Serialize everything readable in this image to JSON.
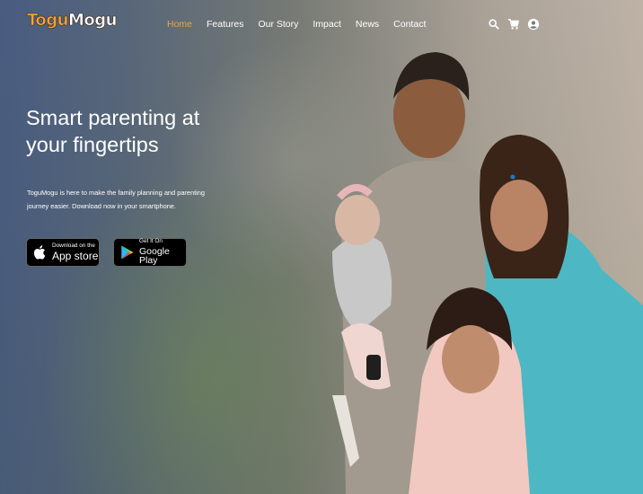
{
  "brand": {
    "logo_part1": "Togu",
    "logo_part2": "Mogu"
  },
  "nav": {
    "items": [
      {
        "label": "Home",
        "active": true
      },
      {
        "label": "Features",
        "active": false
      },
      {
        "label": "Our Story",
        "active": false
      },
      {
        "label": "Impact",
        "active": false
      },
      {
        "label": "News",
        "active": false
      },
      {
        "label": "Contact",
        "active": false
      }
    ],
    "icons": [
      "search-icon",
      "cart-icon",
      "account-icon"
    ]
  },
  "hero": {
    "title_line1": "Smart parenting at",
    "title_line2": "your fingertips",
    "description": "ToguMogu is here to make the family planning and parenting journey easier. Download now in your smartphone."
  },
  "store_buttons": {
    "appstore": {
      "small": "Download on the",
      "big": "App store",
      "icon": "apple-icon"
    },
    "googleplay": {
      "small": "Get It On",
      "big": "Google Play",
      "icon": "google-play-icon"
    }
  },
  "colors": {
    "accent": "#f2a33a",
    "text": "#ffffff",
    "button_bg": "#000000"
  }
}
